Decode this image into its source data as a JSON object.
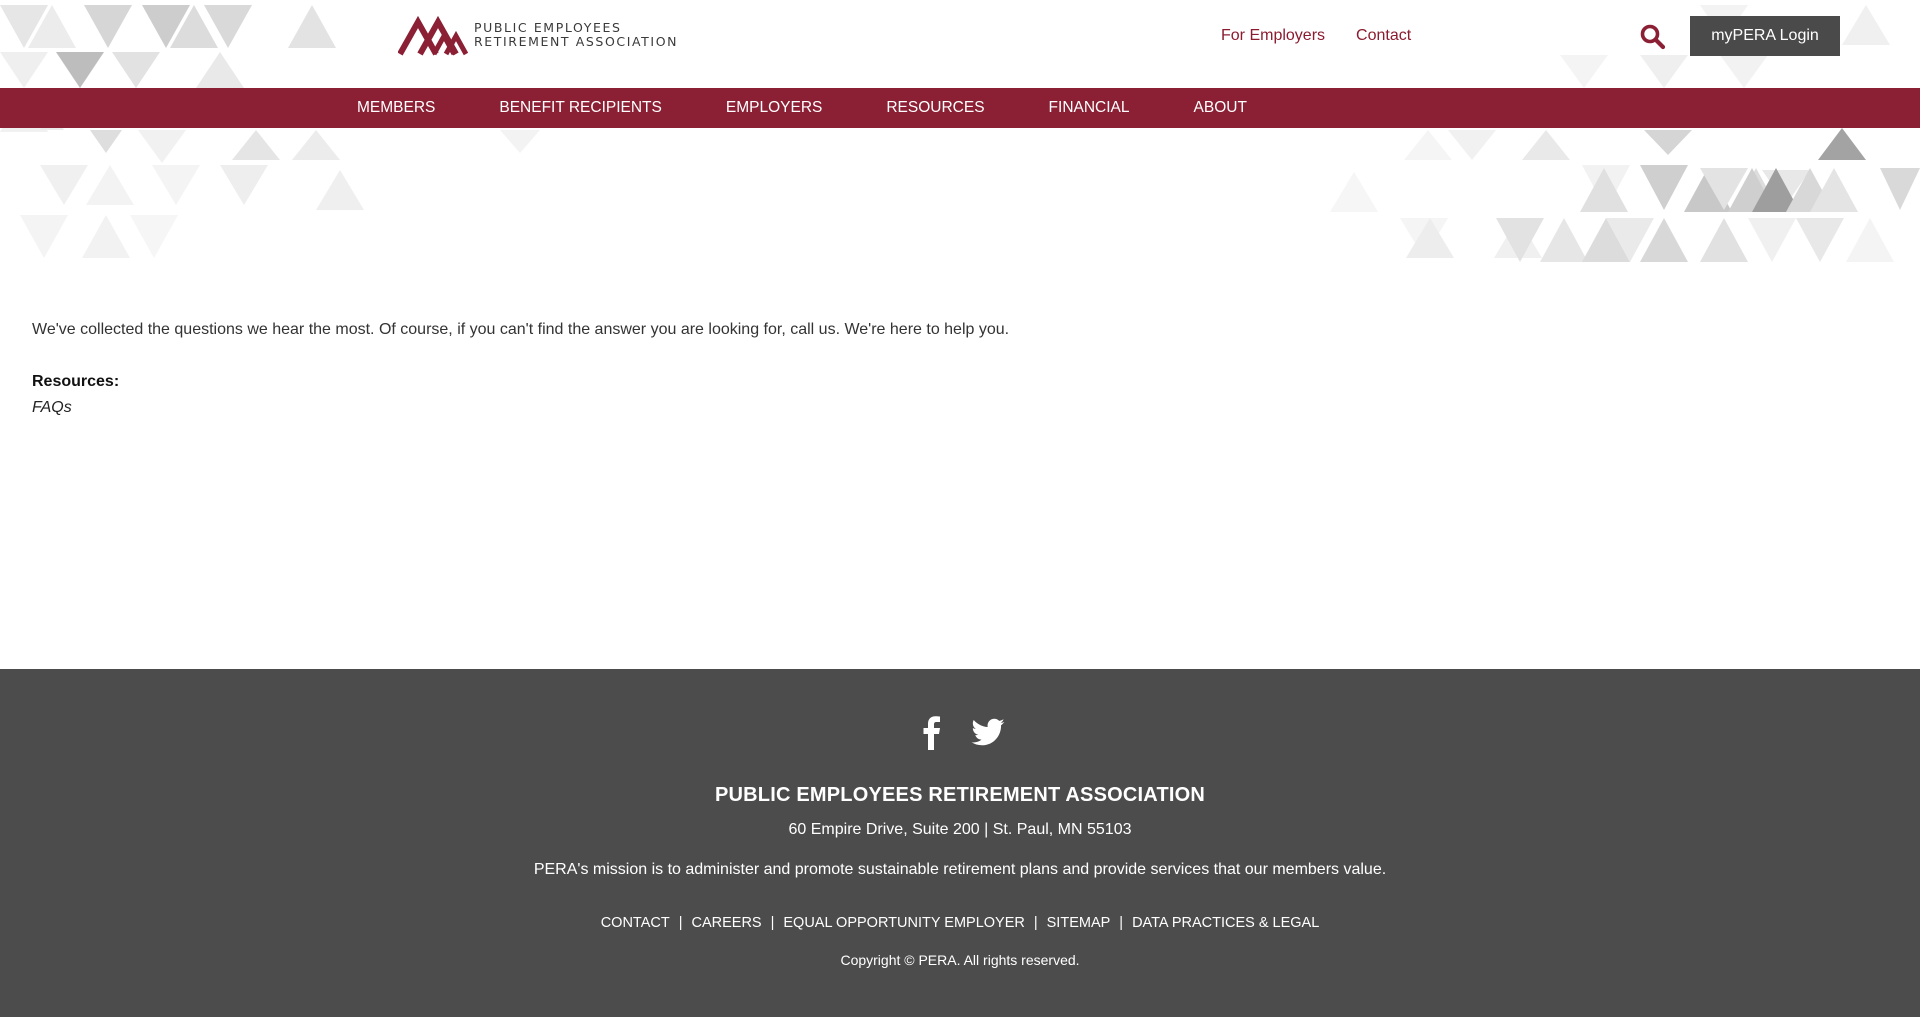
{
  "header": {
    "logo_line1": "PUBLIC EMPLOYEES",
    "logo_line2": "RETIREMENT ASSOCIATION",
    "utility_links": [
      "For Employers",
      "Contact"
    ],
    "login_label": "myPERA Login",
    "search_icon": "search-icon",
    "brand_color": "#8b2035",
    "login_bg": "#4a4a4a"
  },
  "nav": {
    "items": [
      "MEMBERS",
      "BENEFIT RECIPIENTS",
      "EMPLOYERS",
      "RESOURCES",
      "FINANCIAL",
      "ABOUT"
    ]
  },
  "main": {
    "intro": "We've collected the questions we hear the most. Of course, if you can't find the answer you are looking for, call us. We're here to help you.",
    "resources_label": "Resources:",
    "faq_link": "FAQs"
  },
  "footer": {
    "social_icons": [
      "facebook-icon",
      "twitter-icon"
    ],
    "org_name": "PUBLIC EMPLOYEES RETIREMENT ASSOCIATION",
    "address": "60 Empire Drive, Suite 200 | St. Paul, MN 55103",
    "mission": "PERA's mission is to administer and promote sustainable retirement plans and provide services that our members value.",
    "links": [
      "CONTACT",
      "CAREERS",
      "EQUAL OPPORTUNITY EMPLOYER",
      "SITEMAP",
      "DATA PRACTICES & LEGAL"
    ],
    "copyright": "Copyright © PERA. All rights reserved.",
    "background": "#4c4c4c"
  }
}
